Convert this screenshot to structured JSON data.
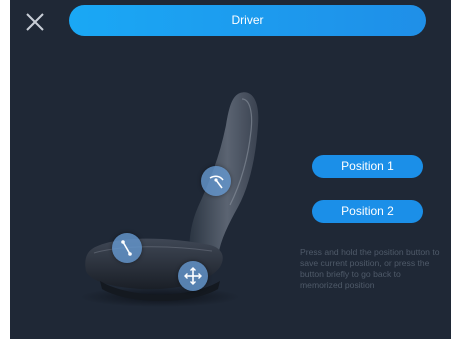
{
  "header": {
    "title": "Driver",
    "close_icon": "close-icon"
  },
  "memory": {
    "position1_label": "Position 1",
    "position2_label": "Position 2",
    "hint": "Press and hold the position button to save current position, or press the button  briefly to go back to memorized position"
  },
  "controls": {
    "backrest_icon": "backrest-angle-icon",
    "cushion_icon": "cushion-tilt-icon",
    "move_icon": "move-arrows-icon"
  },
  "colors": {
    "background": "#1f2836",
    "accent": "#1b8fe8",
    "hint_text": "#4f5a69"
  }
}
